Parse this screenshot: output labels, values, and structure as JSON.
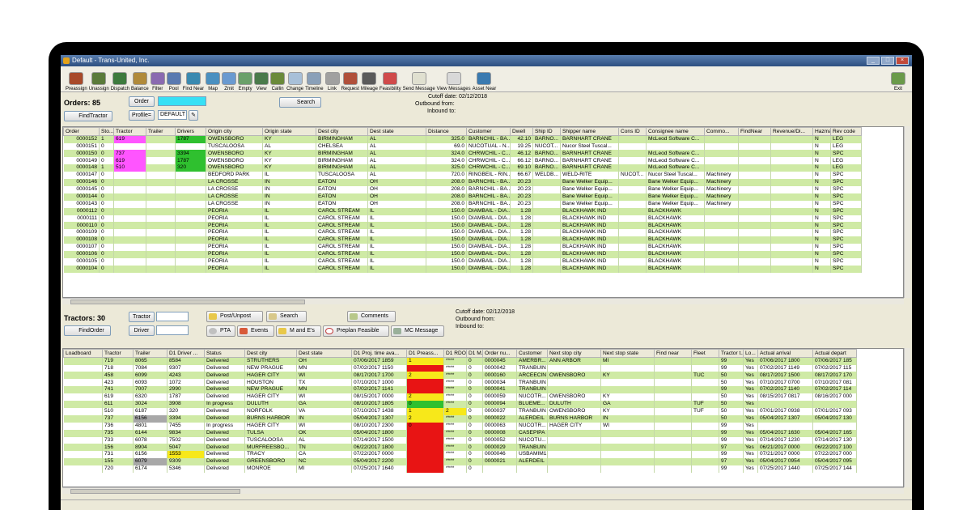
{
  "window": {
    "title": "Default - Trans-United, Inc."
  },
  "toolbar": [
    "Preassign",
    "Unassign",
    "Dispatch",
    "Balance",
    "Filter",
    "Pool",
    "Find Near",
    "Map",
    "Zmit",
    "Empty",
    "View",
    "Callin",
    "Change",
    "Timeline",
    "Link",
    "Request",
    "Mileage",
    "Feasibility",
    "Send Message",
    "View Messages",
    "Asset Near"
  ],
  "toolbar_colors": [
    "#a84a2a",
    "#5a7a3a",
    "#3d7a3d",
    "#b08a3a",
    "#8a6ab0",
    "#5a7ab0",
    "#3a8ab0",
    "#4a90c0",
    "#6a9ad0",
    "#6aa06a",
    "#4a7a4a",
    "#6a8a3a",
    "#a8c0d8",
    "#8aa0b8",
    "#a0a0a0",
    "#b0503a",
    "#5a5a5a",
    "#d04a4a",
    "#e0e0d0",
    "#d8d8d8",
    "#3a7ab0"
  ],
  "exit_label": "Exit",
  "orders": {
    "count_label": "Orders: 85",
    "order_btn": "Order",
    "order_value": "",
    "profile_btn": "Profile=",
    "profile_value": "DEFAULT",
    "find_tractor": "FindTractor",
    "search": "Search",
    "cutoff": "Cutoff date: 02/12/2018",
    "outbound": "Outbound from:",
    "inbound": "Inbound to:",
    "columns": [
      "Order",
      "Sto...",
      "Tractor",
      "Trailer",
      "Drivers",
      "Origin city",
      "Origin state",
      "Dest city",
      "Dest state",
      "Distance",
      "Customer",
      "Dwell",
      "Ship ID",
      "Shipper name",
      "Cons ID",
      "Consignee name",
      "Commo...",
      "FindNear",
      "Revenue/Di...",
      "Hazmat",
      "Rev code"
    ],
    "rows": [
      [
        "0000152",
        "1",
        "619",
        "",
        "1787",
        "OWENSBORO",
        "KY",
        "BIRMINGHAM",
        "AL",
        "325.0",
        "BARNCHIL - BA...",
        "42.10",
        "BARNO...",
        "BARNHART CRANE",
        "",
        "McLeod Software C...",
        "",
        "",
        "",
        "N",
        "LEG"
      ],
      [
        "0000151",
        "0",
        "",
        "",
        "",
        "TUSCALOOSA",
        "AL",
        "CHELSEA",
        "AL",
        "69.0",
        "NUCOTUAL - N...",
        "19.25",
        "NUCOT...",
        "Nucor Steel Tuscal...",
        "",
        "",
        "",
        "",
        "",
        "N",
        "LEG"
      ],
      [
        "0000150",
        "0",
        "737",
        "",
        "3394",
        "OWENSBORO",
        "KY",
        "BIRMINGHAM",
        "AL",
        "324.0",
        "CHRWCHIL - C...",
        "46.12",
        "BARNO...",
        "BARNHART CRANE",
        "",
        "McLeod Software C...",
        "",
        "",
        "",
        "N",
        "SPC"
      ],
      [
        "0000149",
        "0",
        "619",
        "",
        "1787",
        "OWENSBORO",
        "KY",
        "BIRMINGHAM",
        "AL",
        "324.0",
        "CHRWCHIL - C...",
        "66.12",
        "BARNO...",
        "BARNHART CRANE",
        "",
        "McLeod Software C...",
        "",
        "",
        "",
        "N",
        "LEG"
      ],
      [
        "0000148",
        "1",
        "510",
        "",
        "320",
        "OWENSBORO",
        "KY",
        "BIRMINGHAM",
        "AL",
        "325.0",
        "CHRWCHIL - C...",
        "69.10",
        "BARNO...",
        "BARNHART CRANE",
        "",
        "McLeod Software C...",
        "",
        "",
        "",
        "N",
        "LEG"
      ],
      [
        "0000147",
        "0",
        "",
        "",
        "",
        "BEDFORD PARK",
        "IL",
        "TUSCALOOSA",
        "AL",
        "720.0",
        "RINGBEIL - RIN...",
        "66.67",
        "WELDB...",
        "WELD-RITE",
        "NUCOT...",
        "Nucor Steel Tuscal...",
        "Machinery",
        "",
        "",
        "N",
        "SPC"
      ],
      [
        "0000146",
        "0",
        "",
        "",
        "",
        "LA CROSSE",
        "IN",
        "EATON",
        "OH",
        "208.0",
        "BARNCHIL - BA...",
        "20.23",
        "",
        "Bane Welker Equip...",
        "",
        "Bane Welker Equip...",
        "Machinery",
        "",
        "",
        "N",
        "SPC"
      ],
      [
        "0000145",
        "0",
        "",
        "",
        "",
        "LA CROSSE",
        "IN",
        "EATON",
        "OH",
        "208.0",
        "BARNCHIL - BA...",
        "20.23",
        "",
        "Bane Welker Equip...",
        "",
        "Bane Welker Equip...",
        "Machinery",
        "",
        "",
        "N",
        "SPC"
      ],
      [
        "0000144",
        "0",
        "",
        "",
        "",
        "LA CROSSE",
        "IN",
        "EATON",
        "OH",
        "208.0",
        "BARNCHIL - BA...",
        "20.23",
        "",
        "Bane Welker Equip...",
        "",
        "Bane Welker Equip...",
        "Machinery",
        "",
        "",
        "N",
        "SPC"
      ],
      [
        "0000143",
        "0",
        "",
        "",
        "",
        "LA CROSSE",
        "IN",
        "EATON",
        "OH",
        "208.0",
        "BARNCHIL - BA...",
        "20.23",
        "",
        "Bane Welker Equip...",
        "",
        "Bane Welker Equip...",
        "Machinery",
        "",
        "",
        "N",
        "SPC"
      ],
      [
        "0000112",
        "0",
        "",
        "",
        "",
        "PEORIA",
        "IL",
        "CAROL STREAM",
        "IL",
        "150.0",
        "DIAMBAIL - DIA...",
        "1.28",
        "",
        "BLACKHAWK IND",
        "",
        "BLACKHAWK",
        "",
        "",
        "",
        "N",
        "SPC"
      ],
      [
        "0000111",
        "0",
        "",
        "",
        "",
        "PEORIA",
        "IL",
        "CAROL STREAM",
        "IL",
        "150.0",
        "DIAMBAIL - DIA...",
        "1.28",
        "",
        "BLACKHAWK IND",
        "",
        "BLACKHAWK",
        "",
        "",
        "",
        "N",
        "SPC"
      ],
      [
        "0000110",
        "0",
        "",
        "",
        "",
        "PEORIA",
        "IL",
        "CAROL STREAM",
        "IL",
        "150.0",
        "DIAMBAIL - DIA...",
        "1.28",
        "",
        "BLACKHAWK IND",
        "",
        "BLACKHAWK",
        "",
        "",
        "",
        "N",
        "SPC"
      ],
      [
        "0000109",
        "0",
        "",
        "",
        "",
        "PEORIA",
        "IL",
        "CAROL STREAM",
        "IL",
        "150.0",
        "DIAMBAIL - DIA...",
        "1.28",
        "",
        "BLACKHAWK IND",
        "",
        "BLACKHAWK",
        "",
        "",
        "",
        "N",
        "SPC"
      ],
      [
        "0000108",
        "0",
        "",
        "",
        "",
        "PEORIA",
        "IL",
        "CAROL STREAM",
        "IL",
        "150.0",
        "DIAMBAIL - DIA...",
        "1.28",
        "",
        "BLACKHAWK IND",
        "",
        "BLACKHAWK",
        "",
        "",
        "",
        "N",
        "SPC"
      ],
      [
        "0000107",
        "0",
        "",
        "",
        "",
        "PEORIA",
        "IL",
        "CAROL STREAM",
        "IL",
        "150.0",
        "DIAMBAIL - DIA...",
        "1.28",
        "",
        "BLACKHAWK IND",
        "",
        "BLACKHAWK",
        "",
        "",
        "",
        "N",
        "SPC"
      ],
      [
        "0000106",
        "0",
        "",
        "",
        "",
        "PEORIA",
        "IL",
        "CAROL STREAM",
        "IL",
        "150.0",
        "DIAMBAIL - DIA...",
        "1.28",
        "",
        "BLACKHAWK IND",
        "",
        "BLACKHAWK",
        "",
        "",
        "",
        "N",
        "SPC"
      ],
      [
        "0000105",
        "0",
        "",
        "",
        "",
        "PEORIA",
        "IL",
        "CAROL STREAM",
        "IL",
        "150.0",
        "DIAMBAIL - DIA...",
        "1.28",
        "",
        "BLACKHAWK IND",
        "",
        "BLACKHAWK",
        "",
        "",
        "",
        "N",
        "SPC"
      ],
      [
        "0000104",
        "0",
        "",
        "",
        "",
        "PEORIA",
        "IL",
        "CAROL STREAM",
        "IL",
        "150.0",
        "DIAMBAIL - DIA...",
        "1.28",
        "",
        "BLACKHAWK IND",
        "",
        "BLACKHAWK",
        "",
        "",
        "",
        "N",
        "SPC"
      ]
    ],
    "row_bg": [
      "g",
      "w",
      "g",
      "w",
      "g",
      "w",
      "g",
      "w",
      "g",
      "w",
      "g",
      "w",
      "g",
      "w",
      "g",
      "w",
      "g",
      "w",
      "g"
    ],
    "highlights": [
      [
        0,
        2,
        "mag"
      ],
      [
        0,
        4,
        "grn"
      ],
      [
        2,
        2,
        "mag"
      ],
      [
        2,
        4,
        "grn"
      ],
      [
        3,
        2,
        "mag"
      ],
      [
        3,
        4,
        "grn"
      ],
      [
        4,
        2,
        "mag"
      ],
      [
        4,
        4,
        "grn"
      ]
    ]
  },
  "tractors": {
    "count_label": "Tractors: 30",
    "tractor_btn": "Tractor",
    "driver_btn": "Driver",
    "find_order": "FindOrder",
    "post_unpost": "Post/Unpost",
    "search": "Search",
    "comments": "Comments",
    "pta": "PTA",
    "events": "Events",
    "m_and_es": "M and E's",
    "preplan": "Preplan Feasible",
    "mc_message": "MC Message",
    "cutoff": "Cutoff date: 02/12/2018",
    "outbound": "Outbound from:",
    "inbound": "Inbound to:",
    "columns": [
      "Loadboard",
      "Tractor",
      "Trailer",
      "D1 Driver ...",
      "Status",
      "Dest city",
      "Dest state",
      "D1 Proj. time ava...",
      "D1 Preass...",
      "D1 RDO",
      "D1 M...",
      "Order nu...",
      "Customer",
      "Next stop city",
      "Next stop state",
      "Find near",
      "Fleet",
      "Tractor t...",
      "Lo...",
      "Actual arrival",
      "Actual depart"
    ],
    "rows": [
      [
        "",
        "719",
        "8065",
        "8584",
        "Delivered",
        "STRUTHERS",
        "OH",
        "07/06/2017 1859",
        "1",
        "****",
        "0",
        "0000045",
        "AMERBR...",
        "ANN ARBOR",
        "MI",
        "",
        "",
        "99",
        "Yes",
        "07/06/2017 1800",
        "07/06/2017 185"
      ],
      [
        "",
        "718",
        "7084",
        "9307",
        "Delivered",
        "NEW PRAGUE",
        "MN",
        "07/02/2017 1150",
        "",
        "****",
        "0",
        "0000042",
        "TRANBUIN",
        "",
        "",
        "",
        "",
        "99",
        "Yes",
        "07/02/2017 1149",
        "07/02/2017 115"
      ],
      [
        "",
        "458",
        "6099",
        "4243",
        "Delivered",
        "HAGER CITY",
        "WI",
        "08/17/2017 1700",
        "2",
        "****",
        "0",
        "0000160",
        "ARCEECIN",
        "OWENSBORO",
        "KY",
        "",
        "TUC",
        "50",
        "Yes",
        "08/17/2017 1500",
        "08/17/2017 170"
      ],
      [
        "",
        "423",
        "6093",
        "1072",
        "Delivered",
        "HOUSTON",
        "TX",
        "07/10/2017 1000",
        "",
        "****",
        "0",
        "0000034",
        "TRANBUIN",
        "",
        "",
        "",
        "",
        "50",
        "Yes",
        "07/10/2017 0700",
        "07/10/2017 081"
      ],
      [
        "",
        "741",
        "7007",
        "2990",
        "Delivered",
        "NEW PRAGUE",
        "MN",
        "07/02/2017 1141",
        "",
        "****",
        "0",
        "0000041",
        "TRANBUIN",
        "",
        "",
        "",
        "",
        "99",
        "Yes",
        "07/02/2017 1140",
        "07/02/2017 114"
      ],
      [
        "",
        "619",
        "6320",
        "1787",
        "Delivered",
        "HAGER CITY",
        "WI",
        "08/15/2017 0000",
        "2",
        "****",
        "0",
        "0000059",
        "NUCOTR...",
        "OWENSBORO",
        "KY",
        "",
        "",
        "50",
        "Yes",
        "08/15/2017 0817",
        "08/16/2017 000"
      ],
      [
        "",
        "611",
        "3024",
        "3908",
        "In progress",
        "DULUTH",
        "GA",
        "08/10/2017 1805",
        "0",
        "****",
        "0",
        "0000094",
        "BLUEME...",
        "DULUTH",
        "GA",
        "",
        "TUF",
        "50",
        "Yes",
        "",
        ""
      ],
      [
        "",
        "510",
        "6187",
        "320",
        "Delivered",
        "NORFOLK",
        "VA",
        "07/10/2017 1438",
        "1",
        "2",
        "0",
        "0000037",
        "TRANBUIN",
        "OWENSBORO",
        "KY",
        "",
        "TUF",
        "50",
        "Yes",
        "07/01/2017 0938",
        "07/01/2017 093"
      ],
      [
        "",
        "737",
        "6156",
        "3394",
        "Delivered",
        "BURNS HARBOR",
        "IN",
        "05/04/2017 1307",
        "2",
        "****",
        "0",
        "0000022",
        "ALERDEIL",
        "BURNS HARBOR",
        "IN",
        "",
        "",
        "50",
        "Yes",
        "05/04/2017 1307",
        "05/04/2017 130"
      ],
      [
        "",
        "736",
        "4801",
        "7455",
        "In progress",
        "HAGER CITY",
        "WI",
        "08/10/2017 2300",
        "0",
        "****",
        "0",
        "0000063",
        "NUCOTR...",
        "HAGER CITY",
        "WI",
        "",
        "",
        "99",
        "Yes",
        "",
        ""
      ],
      [
        "",
        "735",
        "6144",
        "9834",
        "Delivered",
        "TULSA",
        "OK",
        "05/04/2017 1800",
        "",
        "****",
        "0",
        "0000008",
        "CASEPIPA",
        "",
        "",
        "",
        "",
        "99",
        "Yes",
        "05/04/2017 1630",
        "05/04/2017 165"
      ],
      [
        "",
        "733",
        "6078",
        "7502",
        "Delivered",
        "TUSCALOOSA",
        "AL",
        "07/14/2017 1500",
        "",
        "****",
        "0",
        "0000052",
        "NUCOTU...",
        "",
        "",
        "",
        "",
        "99",
        "Yes",
        "07/14/2017 1230",
        "07/14/2017 130"
      ],
      [
        "",
        "156",
        "8904",
        "5047",
        "Delivered",
        "MURFREESBO...",
        "TN",
        "06/22/2017 1800",
        "",
        "****",
        "0",
        "0000029",
        "TRANBUIN",
        "",
        "",
        "",
        "",
        "97",
        "Yes",
        "06/21/2017 0000",
        "06/22/2017 100"
      ],
      [
        "",
        "731",
        "6156",
        "1553",
        "Delivered",
        "TRACY",
        "CA",
        "07/22/2017 0000",
        "",
        "****",
        "0",
        "0000046",
        "USBAMIM1",
        "",
        "",
        "",
        "",
        "99",
        "Yes",
        "07/21/2017 0000",
        "07/22/2017 000"
      ],
      [
        "",
        "155",
        "6079",
        "9309",
        "Delivered",
        "GREENSBORO",
        "NC",
        "05/04/2017 2200",
        "",
        "****",
        "0",
        "0000021",
        "ALERDEIL",
        "",
        "",
        "",
        "",
        "97",
        "Yes",
        "05/04/2017 0954",
        "05/04/2017 095"
      ],
      [
        "",
        "720",
        "6174",
        "5346",
        "Delivered",
        "MONROE",
        "MI",
        "07/25/2017 1640",
        "",
        "****",
        "0",
        "",
        "",
        "",
        "",
        "",
        "",
        "99",
        "Yes",
        "07/25/2017 1440",
        "07/25/2017 144"
      ]
    ],
    "row_bg": [
      "g",
      "w",
      "g",
      "w",
      "g",
      "w",
      "g",
      "w",
      "g",
      "w",
      "g",
      "w",
      "g",
      "w",
      "g",
      "w"
    ],
    "highlights": [
      [
        0,
        8,
        "yel"
      ],
      [
        1,
        8,
        "red"
      ],
      [
        2,
        8,
        "yel"
      ],
      [
        3,
        8,
        "red"
      ],
      [
        4,
        8,
        "red"
      ],
      [
        5,
        8,
        "yel"
      ],
      [
        6,
        8,
        "grn"
      ],
      [
        7,
        8,
        "yel"
      ],
      [
        7,
        9,
        "yel"
      ],
      [
        8,
        8,
        "yel"
      ],
      [
        9,
        8,
        "red"
      ],
      [
        10,
        8,
        "red"
      ],
      [
        11,
        8,
        "red"
      ],
      [
        12,
        8,
        "red"
      ],
      [
        13,
        8,
        "red"
      ],
      [
        14,
        8,
        "red"
      ],
      [
        15,
        8,
        "red"
      ],
      [
        13,
        3,
        "yel"
      ],
      [
        8,
        2,
        "grey"
      ],
      [
        14,
        2,
        "grey"
      ]
    ]
  },
  "scroll_glyph": "III"
}
